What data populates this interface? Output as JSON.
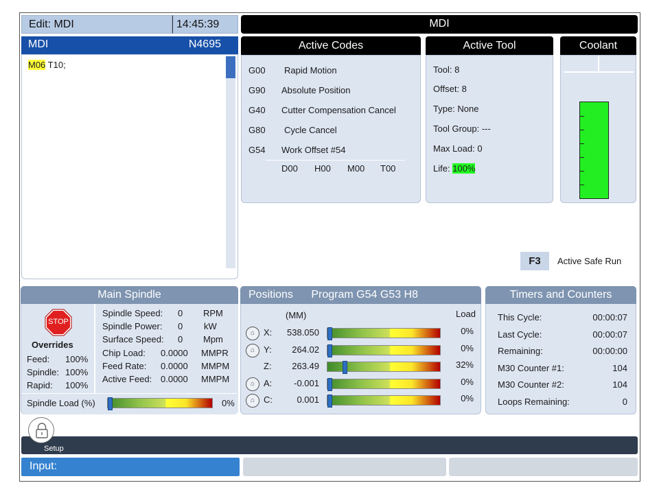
{
  "top": {
    "edit_label": "Edit: MDI",
    "time": "14:45:39",
    "mode_title": "MDI"
  },
  "editor": {
    "title": "MDI",
    "line_number": "N4695",
    "code_hl": "M06",
    "code_rest": " T10;"
  },
  "active_codes": {
    "title": "Active Codes",
    "codes": [
      {
        "code": "G00",
        "desc": "Rapid Motion"
      },
      {
        "code": "G90",
        "desc": "Absolute Position"
      },
      {
        "code": "G40",
        "desc": "Cutter Compensation Cancel"
      },
      {
        "code": "G80",
        "desc": "Cycle Cancel"
      },
      {
        "code": "G54",
        "desc": "Work Offset #54"
      }
    ],
    "extra": [
      "D00",
      "H00",
      "M00",
      "T00"
    ]
  },
  "active_tool": {
    "title": "Active Tool",
    "tool": "Tool: 8",
    "offset": "Offset: 8",
    "type": "Type: None",
    "group": "Tool Group: ---",
    "max_load": "Max Load: 0",
    "life_label": "Life: ",
    "life_value": "100%"
  },
  "coolant": {
    "title": "Coolant",
    "level_fraction": 1.0
  },
  "safe_run": {
    "key": "F3",
    "label": "Active Safe Run"
  },
  "spindle": {
    "title": "Main Spindle",
    "stop_label": "STOP",
    "overrides_title": "Overrides",
    "overrides": [
      {
        "label": "Feed:",
        "value": "100%"
      },
      {
        "label": "Spindle:",
        "value": "100%"
      },
      {
        "label": "Rapid:",
        "value": "100%"
      }
    ],
    "stats": [
      {
        "label": "Spindle Speed:",
        "value": "0",
        "unit": "RPM"
      },
      {
        "label": "Spindle Power:",
        "value": "0",
        "unit": "kW"
      },
      {
        "label": "Surface Speed:",
        "value": "0",
        "unit": "Mpm"
      },
      {
        "label": "Chip Load:",
        "value": "0.0000",
        "unit": "MMPR"
      },
      {
        "label": "Feed Rate:",
        "value": "0.0000",
        "unit": "MMPM"
      },
      {
        "label": "Active Feed:",
        "value": "0.0000",
        "unit": "MMPM"
      }
    ],
    "load_label": "Spindle Load (%)",
    "load_value": "0%",
    "load_fraction": 0.0
  },
  "positions": {
    "title": "Positions",
    "program": "Program G54 G53 H8",
    "units": "(MM)",
    "load_header": "Load",
    "axes": [
      {
        "axis": "X:",
        "value": "538.050",
        "load": "0%",
        "home": true,
        "fraction": 0.0
      },
      {
        "axis": "Y:",
        "value": "264.02",
        "load": "0%",
        "home": true,
        "fraction": 0.0
      },
      {
        "axis": "Z:",
        "value": "263.49",
        "load": "32%",
        "home": false,
        "fraction": 0.14
      },
      {
        "axis": "A:",
        "value": "-0.001",
        "load": "0%",
        "home": true,
        "fraction": 0.0
      },
      {
        "axis": "C:",
        "value": "0.001",
        "load": "0%",
        "home": true,
        "fraction": 0.0
      }
    ]
  },
  "timers": {
    "title": "Timers and Counters",
    "rows": [
      {
        "label": "This Cycle:",
        "value": "00:00:07"
      },
      {
        "label": "Last Cycle:",
        "value": "00:00:07"
      },
      {
        "label": "Remaining:",
        "value": "00:00:00"
      },
      {
        "label": "M30 Counter #1:",
        "value": "104"
      },
      {
        "label": "M30 Counter #2:",
        "value": "104"
      },
      {
        "label": "Loops Remaining:",
        "value": "0"
      }
    ]
  },
  "bottom": {
    "setup_label": "Setup",
    "input_label": "Input:"
  }
}
